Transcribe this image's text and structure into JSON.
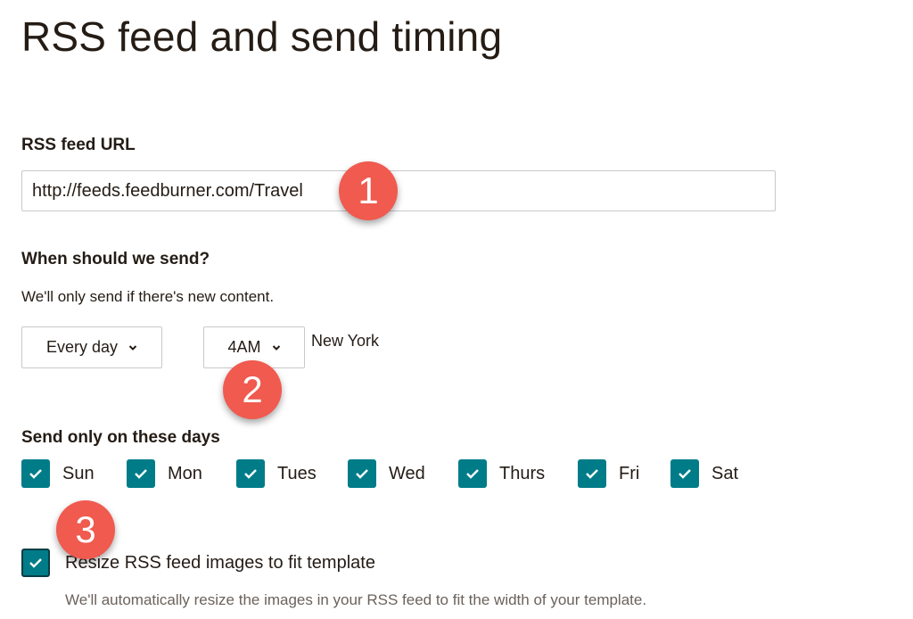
{
  "page_title": "RSS feed and send timing",
  "rss_url": {
    "label": "RSS feed URL",
    "value": "http://feeds.feedburner.com/Travel"
  },
  "send_timing": {
    "label": "When should we send?",
    "helper": "We'll only send if there's new content.",
    "frequency": "Every day",
    "time": "4AM",
    "timezone": "New York"
  },
  "days": {
    "label": "Send only on these days",
    "items": [
      {
        "label": "Sun",
        "checked": true
      },
      {
        "label": "Mon",
        "checked": true
      },
      {
        "label": "Tues",
        "checked": true
      },
      {
        "label": "Wed",
        "checked": true
      },
      {
        "label": "Thurs",
        "checked": true
      },
      {
        "label": "Fri",
        "checked": true
      },
      {
        "label": "Sat",
        "checked": true
      }
    ]
  },
  "resize": {
    "label": "Resize RSS feed images to fit template",
    "checked": true,
    "helper": "We'll automatically resize the images in your RSS feed to fit the width of your template."
  },
  "annotations": [
    "1",
    "2",
    "3"
  ],
  "colors": {
    "accent": "#007c89",
    "badge": "#f05a4f",
    "text": "#241c15"
  }
}
